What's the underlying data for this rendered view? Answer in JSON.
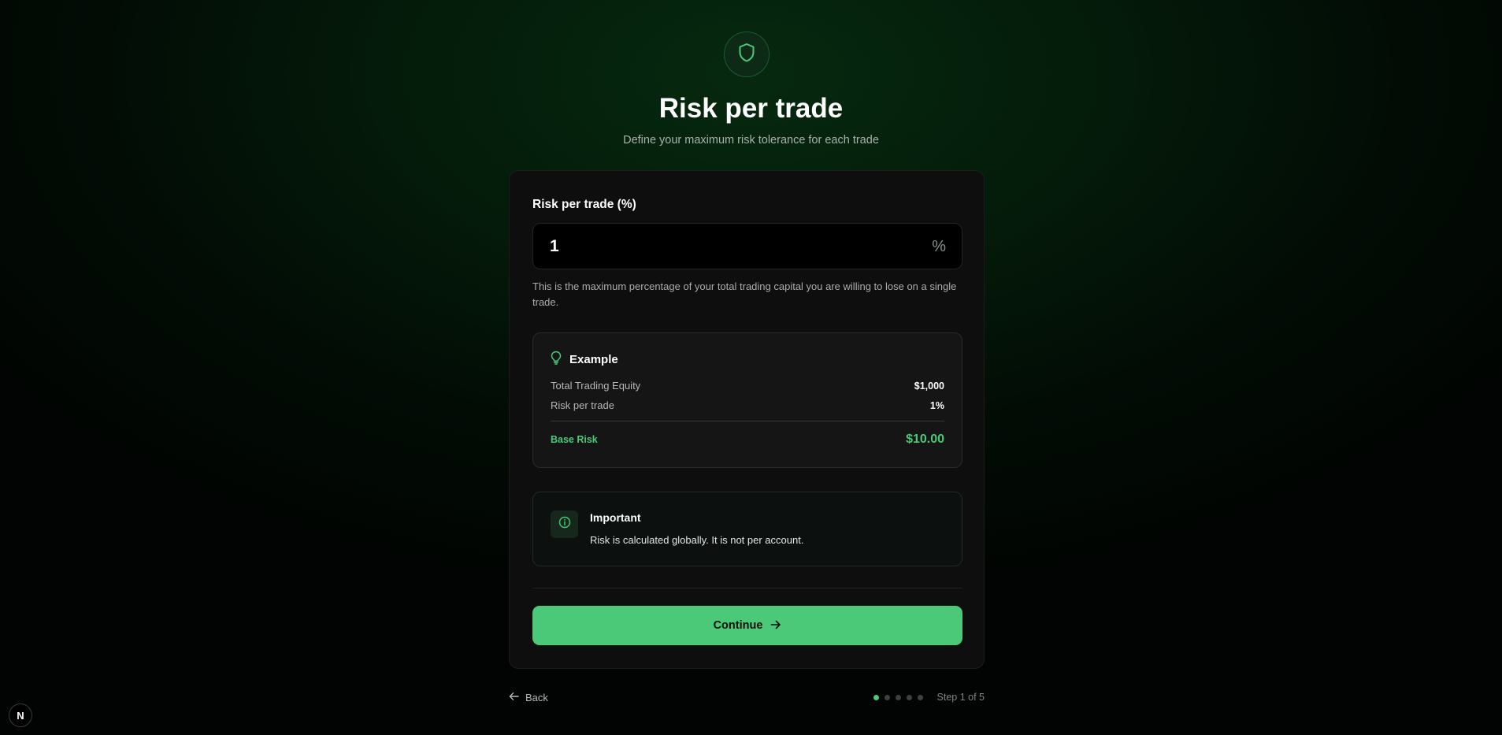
{
  "header": {
    "icon": "shield-icon",
    "title": "Risk per trade",
    "subtitle": "Define your maximum risk tolerance for each trade"
  },
  "form": {
    "field_label": "Risk per trade (%)",
    "value": "1",
    "unit": "%",
    "help_text": "This is the maximum percentage of your total trading capital you are willing to lose on a single trade."
  },
  "example": {
    "icon": "lightbulb-icon",
    "title": "Example",
    "rows": [
      {
        "label": "Total Trading Equity",
        "value": "$1,000"
      },
      {
        "label": "Risk per trade",
        "value": "1%"
      }
    ],
    "total_label": "Base Risk",
    "total_value": "$10.00"
  },
  "important": {
    "icon": "info-icon",
    "title": "Important",
    "text": "Risk is calculated globally. It is not per account."
  },
  "actions": {
    "continue_label": "Continue",
    "back_label": "Back"
  },
  "progress": {
    "total_steps": 5,
    "current_step": 1,
    "label": "Step 1 of 5"
  },
  "dev_badge": {
    "label": "N"
  },
  "colors": {
    "accent": "#4bc978",
    "card_bg": "#0e0e0e",
    "page_bg": "#020c05"
  }
}
